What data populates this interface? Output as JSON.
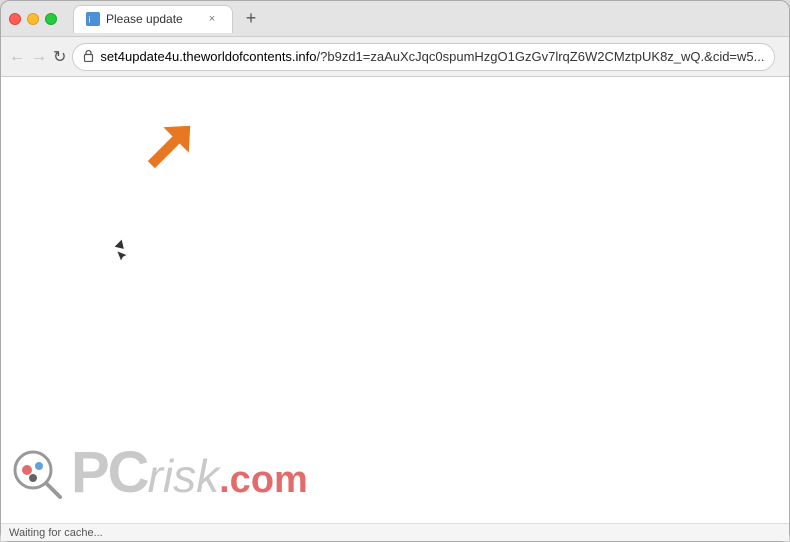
{
  "window": {
    "title": "Please update",
    "controls": {
      "close_label": "×",
      "minimize_label": "−",
      "maximize_label": "+"
    }
  },
  "tab": {
    "favicon_alt": "page icon",
    "title": "Please update",
    "close_label": "×"
  },
  "new_tab_btn": "+",
  "toolbar": {
    "back_label": "←",
    "forward_label": "→",
    "reload_label": "↻",
    "address": {
      "lock_icon": "🔒",
      "domain": "set4update4u.theworldofcontents.info",
      "path": "/?b9zd1=zaAuXcJqc0spumHzgO1GzGv7lrqZ6W2CMztpUK8z_wQ.&cid=w5..."
    },
    "bookmark_label": "☆",
    "profile_label": "👤",
    "error_label": "×"
  },
  "arrow_annotation": {
    "color": "#e87722",
    "label": "orange arrow pointing up-left at address bar"
  },
  "watermark": {
    "logo_label": "PCrisk logo",
    "pc_text": "PC",
    "risk_text": "risk",
    "com_text": ".com"
  },
  "status_bar": {
    "text": "Waiting for cache..."
  }
}
